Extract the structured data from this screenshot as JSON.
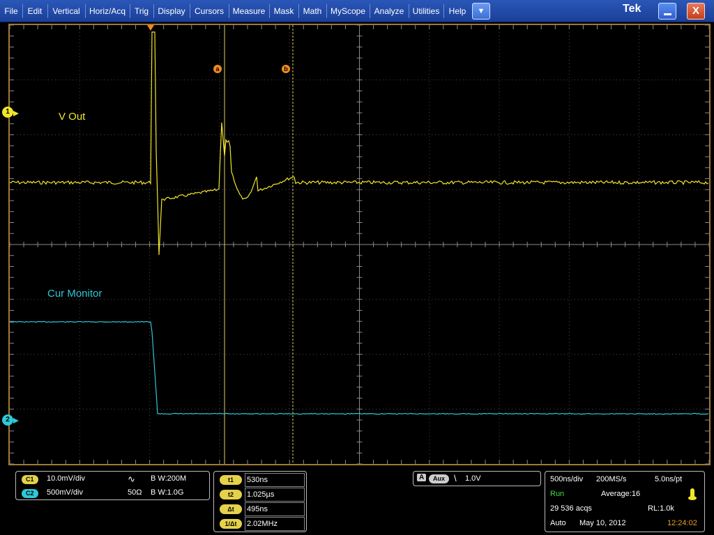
{
  "menu": {
    "items": [
      "File",
      "Edit",
      "Vertical",
      "Horiz/Acq",
      "Trig",
      "Display",
      "Cursors",
      "Measure",
      "Mask",
      "Math",
      "MyScope",
      "Analyze",
      "Utilities",
      "Help"
    ],
    "dropdown_icon": "chevron-down-icon",
    "brand": "Tek",
    "minimize_icon": "minimize-icon",
    "close_glyph": "X"
  },
  "waveform": {
    "ch1_label": "V Out",
    "ch2_label": "Cur Monitor",
    "ch1_marker": "1",
    "ch2_marker": "2",
    "cursor_a": "a",
    "cursor_b": "b",
    "ch1_color": "#f0e62a",
    "ch2_color": "#2ec8d8",
    "cursor_color": "#f08a1c"
  },
  "channels": {
    "c1": {
      "tag": "C1",
      "scale": "10.0mV/div",
      "coupling_glyph": "∿",
      "bw": "B W:200M"
    },
    "c2": {
      "tag": "C2",
      "scale": "500mV/div",
      "impedance": "50Ω",
      "bw": "B W:1.0G"
    }
  },
  "cursors": {
    "t1_label": "t1",
    "t1": "530ns",
    "t2_label": "t2",
    "t2": "1.025µs",
    "dt_label": "Δt",
    "dt": "495ns",
    "inv_label": "1/Δt",
    "inv": "2.02MHz"
  },
  "trigger": {
    "source_a": "A",
    "source": "Aux",
    "slope_glyph": "\\",
    "level": "1.0V"
  },
  "acquisition": {
    "timebase": "500ns/div",
    "sample_rate": "200MS/s",
    "resolution": "5.0ns/pt",
    "state": "Run",
    "mode": "Average:16",
    "acqs": "29 536 acqs",
    "record_length": "RL:1.0k",
    "trigger_mode": "Auto",
    "date": "May 10, 2012",
    "time": "12:24:02"
  }
}
